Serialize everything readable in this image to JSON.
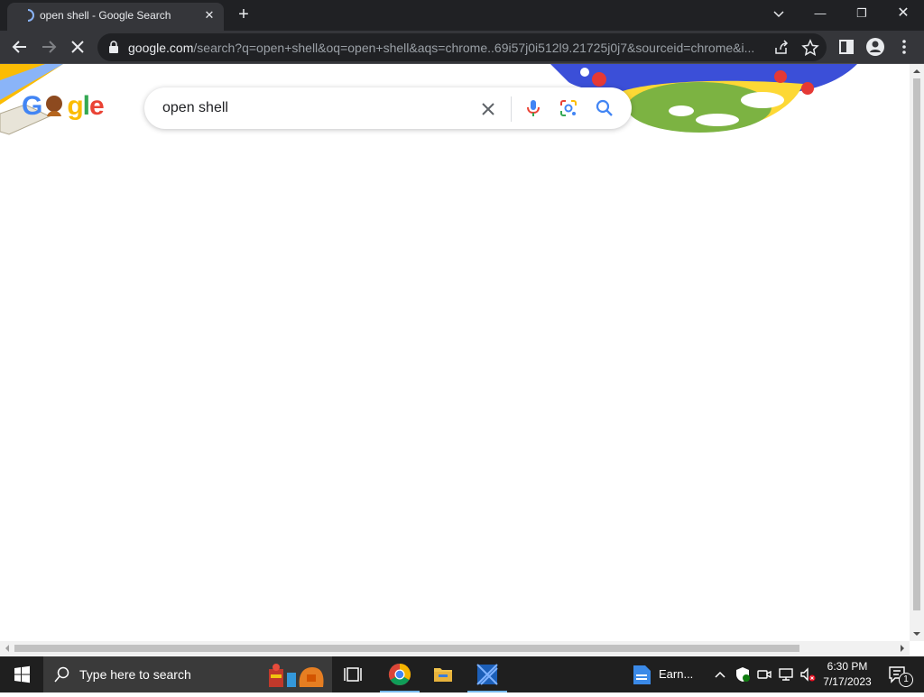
{
  "browser": {
    "tab_title": "open shell - Google Search",
    "url_host": "google.com",
    "url_path": "/search?q=open+shell&oq=open+shell&aqs=chrome..69i57j0i512l9.21725j0j7&sourceid=chrome&i...",
    "accent_color": "#8ab4f8"
  },
  "page": {
    "logo_letters": [
      "G",
      "",
      "g",
      "l",
      "e"
    ],
    "search_query": "open shell"
  },
  "taskbar": {
    "search_placeholder": "Type here to search",
    "earn_label": "Earn...",
    "time": "6:30 PM",
    "date": "7/17/2023",
    "notification_count": "1"
  }
}
